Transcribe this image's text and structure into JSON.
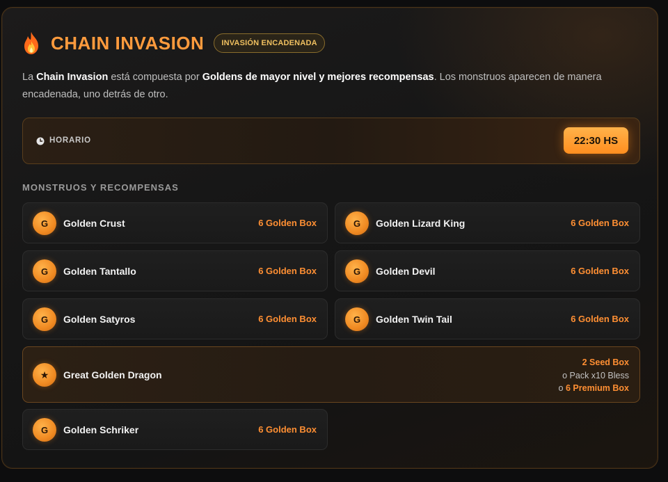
{
  "header": {
    "icon": "fire-icon",
    "title": "CHAIN INVASION",
    "badge": "INVASIÓN ENCADENADA"
  },
  "description": {
    "p1": "La ",
    "b1": "Chain Invasion",
    "p2": " está compuesta por ",
    "b2": "Goldens de mayor nivel y mejores recompensas",
    "p3": ". Los monstruos aparecen de manera encadenada, uno detrás de otro."
  },
  "schedule": {
    "icon": "clock-icon",
    "label": "HORARIO",
    "time": "22:30 HS"
  },
  "section_title": "MONSTRUOS Y RECOMPENSAS",
  "monsters": [
    {
      "icon_text": "G",
      "name": "Golden Crust",
      "reward": "6 Golden Box"
    },
    {
      "icon_text": "G",
      "name": "Golden Lizard King",
      "reward": "6 Golden Box"
    },
    {
      "icon_text": "G",
      "name": "Golden Tantallo",
      "reward": "6 Golden Box"
    },
    {
      "icon_text": "G",
      "name": "Golden Devil",
      "reward": "6 Golden Box"
    },
    {
      "icon_text": "G",
      "name": "Golden Satyros",
      "reward": "6 Golden Box"
    },
    {
      "icon_text": "G",
      "name": "Golden Twin Tail",
      "reward": "6 Golden Box"
    }
  ],
  "boss": {
    "icon_text": "★",
    "name": "Great Golden Dragon",
    "reward_line1": "2 Seed Box",
    "reward_line2": "o Pack x10 Bless",
    "reward_line3_prefix": "o ",
    "reward_line3_value": "6 Premium Box"
  },
  "last": {
    "icon_text": "G",
    "name": "Golden Schriker",
    "reward": "6 Golden Box"
  },
  "colors": {
    "accent": "#ff9b3d",
    "reward": "#ff8f33",
    "badge_text": "#f0c060"
  }
}
